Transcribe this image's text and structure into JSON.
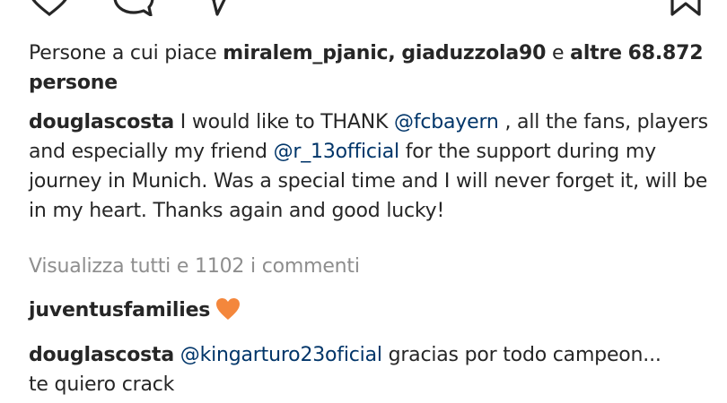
{
  "colors": {
    "text": "#262626",
    "muted": "#8e8e8e",
    "mention": "#003569",
    "heart": "#f4873c"
  },
  "icons": {
    "like": "heart-outline-icon",
    "comment": "comment-bubble-icon",
    "share": "send-icon",
    "save": "bookmark-icon",
    "emoji": "orange-heart-emoji"
  },
  "likes": {
    "prefix": "Persone a cui piace",
    "user1": "miralem_pjanic,",
    "user2": "giaduzzola90",
    "conj": "e",
    "others_word": "altre",
    "count_text": "68.872 persone"
  },
  "caption": {
    "username": "douglascosta",
    "text1": "I would like to THANK",
    "mention1": "@fcbayern",
    "text2": ", all the fans, players and especially my friend",
    "mention2": "@r_13official",
    "text3": "for the support during my journey in Munich. Was a special time and I will never forget it, will be in my heart. Thanks again and good lucky!"
  },
  "view_all": "Visualizza tutti e 1102 i commenti",
  "comments": [
    {
      "username": "juventusfamilies",
      "text": ""
    },
    {
      "username": "douglascosta",
      "mention": "@kingarturo23oficial",
      "text": "gracias por todo campeon...",
      "text_line2": "te quiero crack"
    }
  ]
}
